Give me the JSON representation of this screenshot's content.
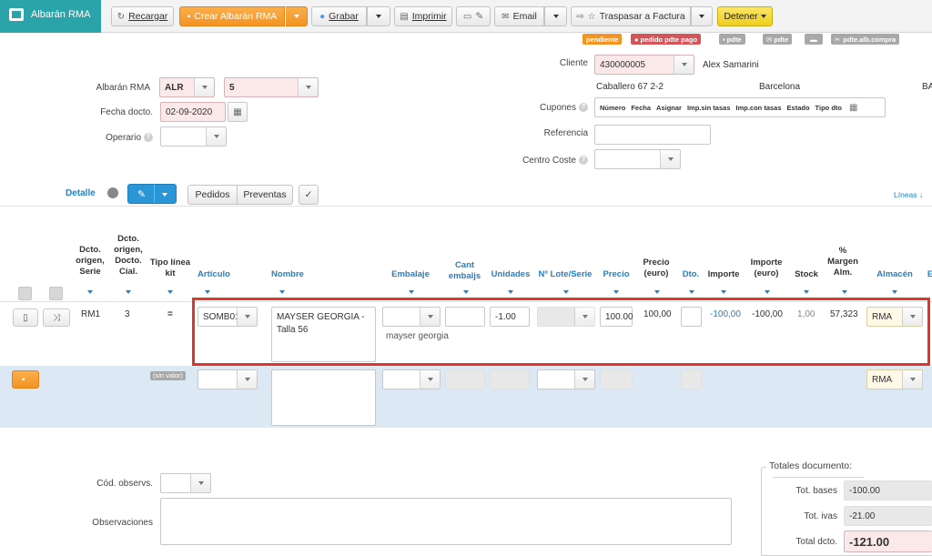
{
  "app": {
    "title": "Albarán RMA"
  },
  "toolbar": {
    "reload": "Recargar",
    "create": "Crear Albarán RMA",
    "save": "Grabar",
    "print": "Imprimir",
    "email": "Email",
    "transfer": "Traspasar a Factura",
    "stop": "Detener"
  },
  "badges": {
    "pendiente": "pendiente",
    "pedido_pdte_pago": "pedido pdte pago",
    "pdte1": "pdte",
    "pdte2": "pdte",
    "pdte_alb_compra": "pdte.alb.compra"
  },
  "form": {
    "albaran_label": "Albarán RMA",
    "serie": "ALR",
    "numero": "5",
    "fecha_label": "Fecha docto.",
    "fecha": "02-09-2020",
    "operario_label": "Operario",
    "cliente_label": "Cliente",
    "cliente_code": "430000005",
    "cliente_name": "Alex Samarini",
    "address": "Caballero 67 2-2",
    "city": "Barcelona",
    "region": "BA",
    "cupones_label": "Cupones",
    "cupones_cols": [
      "Número",
      "Fecha",
      "Asignar",
      "Imp.sin tasas",
      "Imp.con tasas",
      "Estado",
      "Tipo dto"
    ],
    "referencia_label": "Referencia",
    "centro_label": "Centro Coste"
  },
  "detail": {
    "tab_label": "Detalle",
    "pedidos": "Pedidos",
    "preventas": "Preventas",
    "lineas": "Líneas"
  },
  "table": {
    "headers": {
      "dcto_origen_serie": "Dcto. origen, Serie",
      "dcto_origen_cial": "Dcto. origen, Docto. Cial.",
      "tipo_linea": "Tipo línea kit",
      "articulo": "Artículo",
      "nombre": "Nombre",
      "embalaje": "Embalaje",
      "cant_embalajes": "Cant embaljs",
      "unidades": "Unidades",
      "lote": "Nº Lote/Serie",
      "precio": "Precio",
      "precio_euro": "Precio (euro)",
      "dto": "Dto.",
      "importe": "Importe",
      "importe_euro": "Importe (euro)",
      "stock": "Stock",
      "margen": "% Margen Alm.",
      "almacen": "Almacén"
    },
    "row": {
      "serie": "RM1",
      "cial": "3",
      "tipo": "=",
      "articulo": "SOMB01",
      "nombre": "MAYSER GEORGIA - Talla 56",
      "embalaje_desc": "mayser georgia",
      "unidades": "-1.00",
      "precio": "100.00",
      "precio_euro": "100,00",
      "importe": "-100,00",
      "importe_euro": "-100,00",
      "stock": "1,00",
      "margen": "57,323",
      "almacen": "RMA"
    },
    "new_row": {
      "tipo": "(sin valor)",
      "almacen": "RMA"
    }
  },
  "footer": {
    "cod_obs_label": "Cód. observs.",
    "obs_label": "Observaciones",
    "totals_title": "Totales documento:",
    "bases_label": "Tot. bases",
    "bases": "-100.00",
    "ivas_label": "Tot. ivas",
    "ivas": "-21.00",
    "total_label": "Total dcto.",
    "total": "-121.00"
  },
  "colors": {
    "accent": "#2aa4a9",
    "orange": "#f39422",
    "blue": "#2480c6",
    "highlight": "#e0362a",
    "newrow": "#dce9f5"
  }
}
